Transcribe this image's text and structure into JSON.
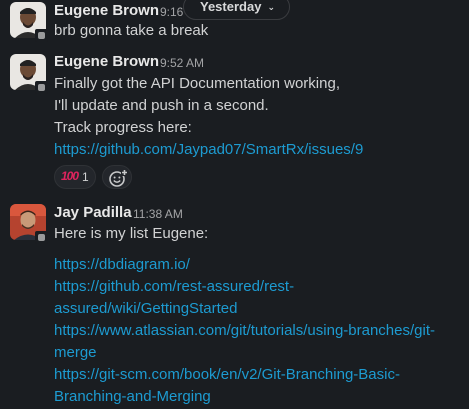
{
  "date_divider": {
    "label": "Yesterday",
    "chevron": "chevron-down-icon"
  },
  "messages": [
    {
      "author": "Eugene Brown",
      "time": "9:16",
      "lines": [
        "brb gonna take a break"
      ]
    },
    {
      "author": "Eugene Brown",
      "time": "9:52 AM",
      "lines": [
        "Finally got the API Documentation working,",
        "I'll update and push in a second.",
        "Track progress here:"
      ],
      "link": "https://github.com/Jaypad07/SmartRx/issues/9",
      "reaction": {
        "emoji": "100",
        "count": "1"
      }
    },
    {
      "author": "Jay Padilla",
      "time": "11:38 AM",
      "lines": [
        "Here is my list Eugene:"
      ],
      "links": [
        "https://dbdiagram.io/",
        "https://github.com/rest-assured/rest-",
        "assured/wiki/GettingStarted",
        "https://www.atlassian.com/git/tutorials/using-branches/git-",
        "merge",
        "https://git-scm.com/book/en/v2/Git-Branching-Basic-",
        "Branching-and-Merging"
      ]
    }
  ],
  "colors": {
    "background": "#1a1d21",
    "link": "#1d9bd1",
    "text": "#d1d2d3",
    "timestamp": "#a3a4a6"
  }
}
